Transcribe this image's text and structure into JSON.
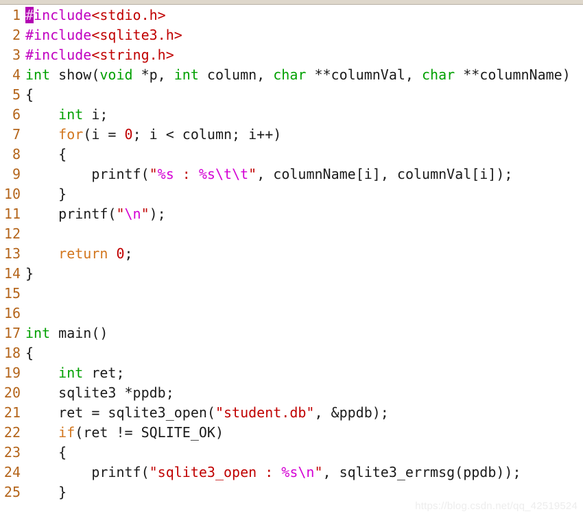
{
  "editor": {
    "language": "C",
    "top_strip_color": "#ded7cb",
    "background_color": "#ffffff",
    "line_number_color": "#b4651b",
    "cursor": {
      "line": 1,
      "column": 1,
      "character": "#",
      "background_color": "#b300b3"
    },
    "colors": {
      "preprocessor": "#c000c0",
      "string": "#c00000",
      "format_spec": "#d400d4",
      "type": "#00a000",
      "keyword": "#d2761e",
      "number": "#c00000",
      "plain": "#1b1b1b"
    }
  },
  "watermark": {
    "text": "https://blog.csdn.net/qq_42519524"
  },
  "code": {
    "first_line_number": 1,
    "last_line_number": 25,
    "plain_text": [
      "#include<stdio.h>",
      "#include<sqlite3.h>",
      "#include<string.h>",
      "int show(void *p, int column, char **columnVal, char **columnName)",
      "{",
      "    int i;",
      "    for(i = 0; i < column; i++)",
      "    {",
      "        printf(\"%s : %s\\t\\t\", columnName[i], columnVal[i]);",
      "    }",
      "    printf(\"\\n\");",
      "",
      "    return 0;",
      "}",
      "",
      "",
      "int main()",
      "{",
      "    int ret;",
      "    sqlite3 *ppdb;",
      "    ret = sqlite3_open(\"student.db\", &ppdb);",
      "    if(ret != SQLITE_OK)",
      "    {",
      "        printf(\"sqlite3_open : %s\\n\", sqlite3_errmsg(ppdb));",
      "    }"
    ],
    "lines": [
      {
        "num": "1",
        "tokens": [
          {
            "t": "#",
            "c": "cursor"
          },
          {
            "t": "include",
            "c": "t-pre"
          },
          {
            "t": "<stdio.h>",
            "c": "t-header"
          }
        ]
      },
      {
        "num": "2",
        "tokens": [
          {
            "t": "#include",
            "c": "t-pre"
          },
          {
            "t": "<sqlite3.h>",
            "c": "t-header"
          }
        ]
      },
      {
        "num": "3",
        "tokens": [
          {
            "t": "#include",
            "c": "t-pre"
          },
          {
            "t": "<string.h>",
            "c": "t-header"
          }
        ]
      },
      {
        "num": "4",
        "tokens": [
          {
            "t": "int",
            "c": "t-type"
          },
          {
            "t": " show(",
            "c": "t-plain"
          },
          {
            "t": "void",
            "c": "t-type"
          },
          {
            "t": " *p, ",
            "c": "t-plain"
          },
          {
            "t": "int",
            "c": "t-type"
          },
          {
            "t": " column, ",
            "c": "t-plain"
          },
          {
            "t": "char",
            "c": "t-type"
          },
          {
            "t": " **columnVal, ",
            "c": "t-plain"
          },
          {
            "t": "char",
            "c": "t-type"
          },
          {
            "t": " **columnName)",
            "c": "t-plain"
          }
        ]
      },
      {
        "num": "5",
        "tokens": [
          {
            "t": "{",
            "c": "t-plain"
          }
        ]
      },
      {
        "num": "6",
        "tokens": [
          {
            "t": "    ",
            "c": "t-plain"
          },
          {
            "t": "int",
            "c": "t-type"
          },
          {
            "t": " i;",
            "c": "t-plain"
          }
        ]
      },
      {
        "num": "7",
        "tokens": [
          {
            "t": "    ",
            "c": "t-plain"
          },
          {
            "t": "for",
            "c": "t-kw"
          },
          {
            "t": "(i = ",
            "c": "t-plain"
          },
          {
            "t": "0",
            "c": "t-num"
          },
          {
            "t": "; i < column; i++)",
            "c": "t-plain"
          }
        ]
      },
      {
        "num": "8",
        "tokens": [
          {
            "t": "    {",
            "c": "t-plain"
          }
        ]
      },
      {
        "num": "9",
        "tokens": [
          {
            "t": "        printf(",
            "c": "t-plain"
          },
          {
            "t": "\"",
            "c": "t-string"
          },
          {
            "t": "%s",
            "c": "t-fmt"
          },
          {
            "t": " : ",
            "c": "t-string"
          },
          {
            "t": "%s",
            "c": "t-fmt"
          },
          {
            "t": "\\t\\t",
            "c": "t-fmt"
          },
          {
            "t": "\"",
            "c": "t-string"
          },
          {
            "t": ", columnName[i], columnVal[i]);",
            "c": "t-plain"
          }
        ]
      },
      {
        "num": "10",
        "tokens": [
          {
            "t": "    }",
            "c": "t-plain"
          }
        ]
      },
      {
        "num": "11",
        "tokens": [
          {
            "t": "    printf(",
            "c": "t-plain"
          },
          {
            "t": "\"",
            "c": "t-string"
          },
          {
            "t": "\\n",
            "c": "t-fmt"
          },
          {
            "t": "\"",
            "c": "t-string"
          },
          {
            "t": ");",
            "c": "t-plain"
          }
        ]
      },
      {
        "num": "12",
        "tokens": [
          {
            "t": "",
            "c": "t-plain"
          }
        ]
      },
      {
        "num": "13",
        "tokens": [
          {
            "t": "    ",
            "c": "t-plain"
          },
          {
            "t": "return",
            "c": "t-kw"
          },
          {
            "t": " ",
            "c": "t-plain"
          },
          {
            "t": "0",
            "c": "t-num"
          },
          {
            "t": ";",
            "c": "t-plain"
          }
        ]
      },
      {
        "num": "14",
        "tokens": [
          {
            "t": "}",
            "c": "t-plain"
          }
        ]
      },
      {
        "num": "15",
        "tokens": [
          {
            "t": "",
            "c": "t-plain"
          }
        ]
      },
      {
        "num": "16",
        "tokens": [
          {
            "t": "",
            "c": "t-plain"
          }
        ]
      },
      {
        "num": "17",
        "tokens": [
          {
            "t": "int",
            "c": "t-type"
          },
          {
            "t": " main()",
            "c": "t-plain"
          }
        ]
      },
      {
        "num": "18",
        "tokens": [
          {
            "t": "{",
            "c": "t-plain"
          }
        ]
      },
      {
        "num": "19",
        "tokens": [
          {
            "t": "    ",
            "c": "t-plain"
          },
          {
            "t": "int",
            "c": "t-type"
          },
          {
            "t": " ret;",
            "c": "t-plain"
          }
        ]
      },
      {
        "num": "20",
        "tokens": [
          {
            "t": "    sqlite3 *ppdb;",
            "c": "t-plain"
          }
        ]
      },
      {
        "num": "21",
        "tokens": [
          {
            "t": "    ret = sqlite3_open(",
            "c": "t-plain"
          },
          {
            "t": "\"student.db\"",
            "c": "t-string"
          },
          {
            "t": ", &ppdb);",
            "c": "t-plain"
          }
        ]
      },
      {
        "num": "22",
        "tokens": [
          {
            "t": "    ",
            "c": "t-plain"
          },
          {
            "t": "if",
            "c": "t-kw"
          },
          {
            "t": "(ret != SQLITE_OK)",
            "c": "t-plain"
          }
        ]
      },
      {
        "num": "23",
        "tokens": [
          {
            "t": "    {",
            "c": "t-plain"
          }
        ]
      },
      {
        "num": "24",
        "tokens": [
          {
            "t": "        printf(",
            "c": "t-plain"
          },
          {
            "t": "\"sqlite3_open : ",
            "c": "t-string"
          },
          {
            "t": "%s\\n",
            "c": "t-fmt"
          },
          {
            "t": "\"",
            "c": "t-string"
          },
          {
            "t": ", sqlite3_errmsg(ppdb));",
            "c": "t-plain"
          }
        ]
      },
      {
        "num": "25",
        "tokens": [
          {
            "t": "    }",
            "c": "t-plain"
          }
        ]
      }
    ]
  }
}
